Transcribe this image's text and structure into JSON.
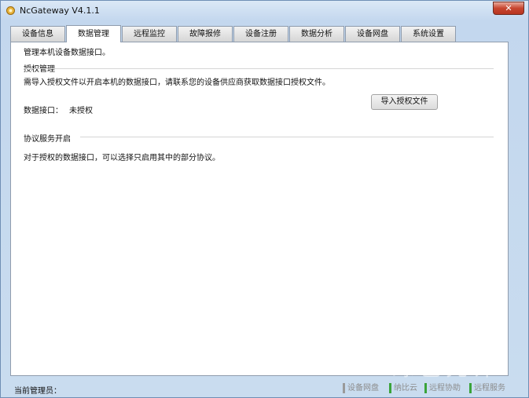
{
  "window": {
    "title": "NcGateway V4.1.1",
    "close_label": "✕"
  },
  "tabs": [
    {
      "label": "设备信息"
    },
    {
      "label": "数据管理"
    },
    {
      "label": "远程监控"
    },
    {
      "label": "故障报修"
    },
    {
      "label": "设备注册"
    },
    {
      "label": "数据分析"
    },
    {
      "label": "设备网盘"
    },
    {
      "label": "系统设置"
    }
  ],
  "active_tab": "数据管理",
  "panel": {
    "intro": "管理本机设备数据接口。",
    "license": {
      "heading": "授权管理",
      "description": "需导入授权文件以开启本机的数据接口，请联系您的设备供应商获取数据接口授权文件。",
      "interface_label": "数据接口：",
      "interface_status": "未授权",
      "import_button": "导入授权文件"
    },
    "protocol": {
      "heading": "协议服务开启",
      "description": "对于授权的数据接口，可以选择只启用其中的部分协议。"
    }
  },
  "statusbar": {
    "admin_label": "当前管理员：",
    "items": [
      {
        "label": "设备网盘",
        "color": "#9a9a9a"
      },
      {
        "label": "纳比云",
        "color": "#3aa33a"
      },
      {
        "label": "远程协助",
        "color": "#3aa33a"
      },
      {
        "label": "远程服务",
        "color": "#3aa33a"
      }
    ]
  },
  "watermark": "绿色先锋"
}
